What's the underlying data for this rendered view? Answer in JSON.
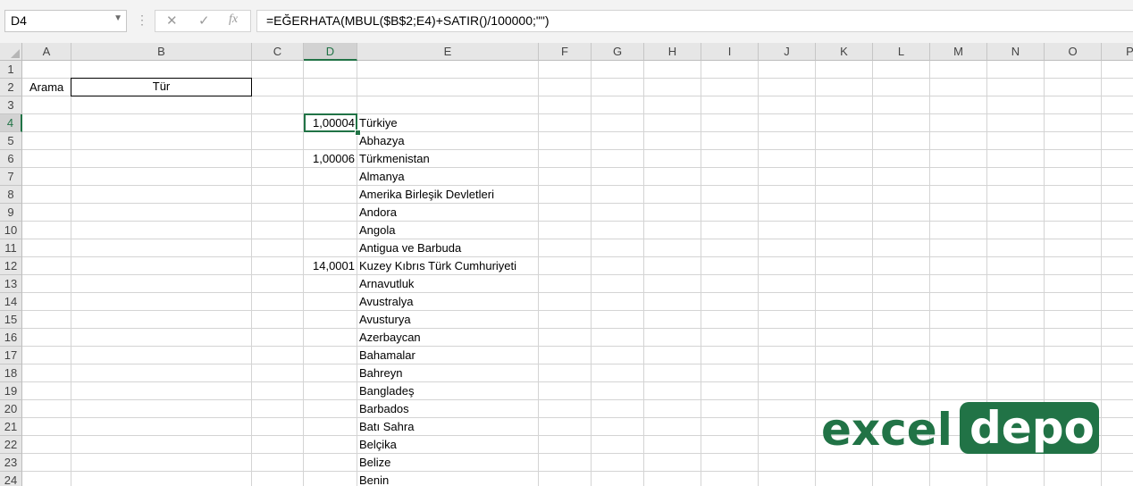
{
  "formula_bar": {
    "name_box": "D4",
    "cancel_icon": "close-icon",
    "enter_icon": "check-icon",
    "function_icon": "function-icon",
    "fx_label": "fx",
    "formula": "=EĞERHATA(MBUL($B$2;E4)+SATIR()/100000;\"\")"
  },
  "columns": [
    "A",
    "B",
    "C",
    "D",
    "E",
    "F",
    "G",
    "H",
    "I",
    "J",
    "K",
    "L",
    "M",
    "N",
    "O",
    "P"
  ],
  "rows": [
    "1",
    "2",
    "3",
    "4",
    "5",
    "6",
    "7",
    "8",
    "9",
    "10",
    "11",
    "12",
    "13",
    "14",
    "15",
    "16",
    "17",
    "18",
    "19",
    "20",
    "21",
    "22",
    "23",
    "24"
  ],
  "selected_cell": "D4",
  "cells": {
    "a2": "Arama",
    "b2": "Tür",
    "d4": "1,00004",
    "d6": "1,00006",
    "d12": "14,0001",
    "e_list": [
      "Türkiye",
      "Abhazya",
      "Türkmenistan",
      "Almanya",
      "Amerika Birleşik Devletleri",
      "Andora",
      "Angola",
      "Antigua ve Barbuda",
      "Kuzey Kıbrıs Türk Cumhuriyeti",
      "Arnavutluk",
      "Avustralya",
      "Avusturya",
      "Azerbaycan",
      "Bahamalar",
      "Bahreyn",
      "Bangladeş",
      "Barbados",
      "Batı Sahra",
      "Belçika",
      "Belize",
      "Benin"
    ]
  },
  "logo": {
    "part1": "excel",
    "part2": "depo",
    "color": "#217346"
  }
}
